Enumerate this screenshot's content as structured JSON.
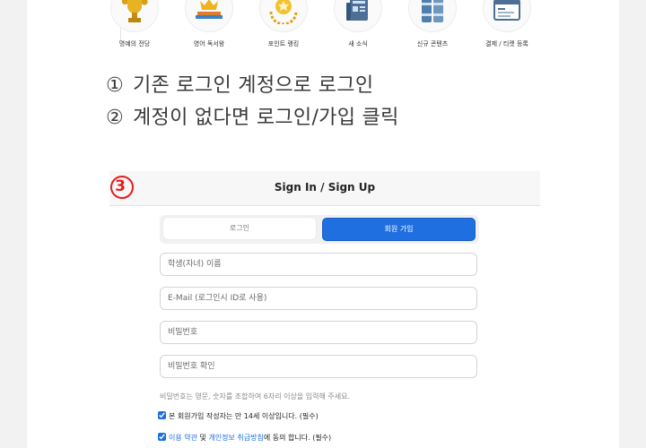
{
  "menu": {
    "items": [
      {
        "label": "명예의 전당",
        "icon": "trophy-icon"
      },
      {
        "label": "영어 독서왕",
        "icon": "crown-books-icon"
      },
      {
        "label": "포인트 랭킹",
        "icon": "medal-icon"
      },
      {
        "label": "새 소식",
        "icon": "newspaper-icon"
      },
      {
        "label": "신규 콘텐츠",
        "icon": "books-icon"
      },
      {
        "label": "결제 / 티켓 등록",
        "icon": "browser-window-icon"
      }
    ]
  },
  "instructions": [
    {
      "num": "①",
      "text": "기존 로그인 계정으로 로그인"
    },
    {
      "num": "②",
      "text": "계정이 없다면 로그인/가입 클릭"
    }
  ],
  "signin": {
    "marker": "3",
    "title": "Sign In / Sign Up",
    "tabs": {
      "login": "로그인",
      "signup": "회원 가입"
    },
    "fields": {
      "name_placeholder": "학생(자녀) 이름",
      "email_placeholder": "E-Mail (로그인시 ID로 사용)",
      "password_placeholder": "비밀번호",
      "confirm_placeholder": "비밀번호 확인"
    },
    "hint": "비밀번호는 영문, 숫자를 조합하여 6자리 이상을 입력해 주세요.",
    "age_check": "본 회원가입 작성자는 만 14세 이상입니다. (필수)",
    "terms": {
      "link1": "이용 약관",
      "mid": " 및 ",
      "link2": "개인정보 취급방침",
      "suffix": "에 동의 합니다. (필수)"
    }
  },
  "colors": {
    "accent": "#1f6fe0",
    "marker": "#e51b1b"
  }
}
